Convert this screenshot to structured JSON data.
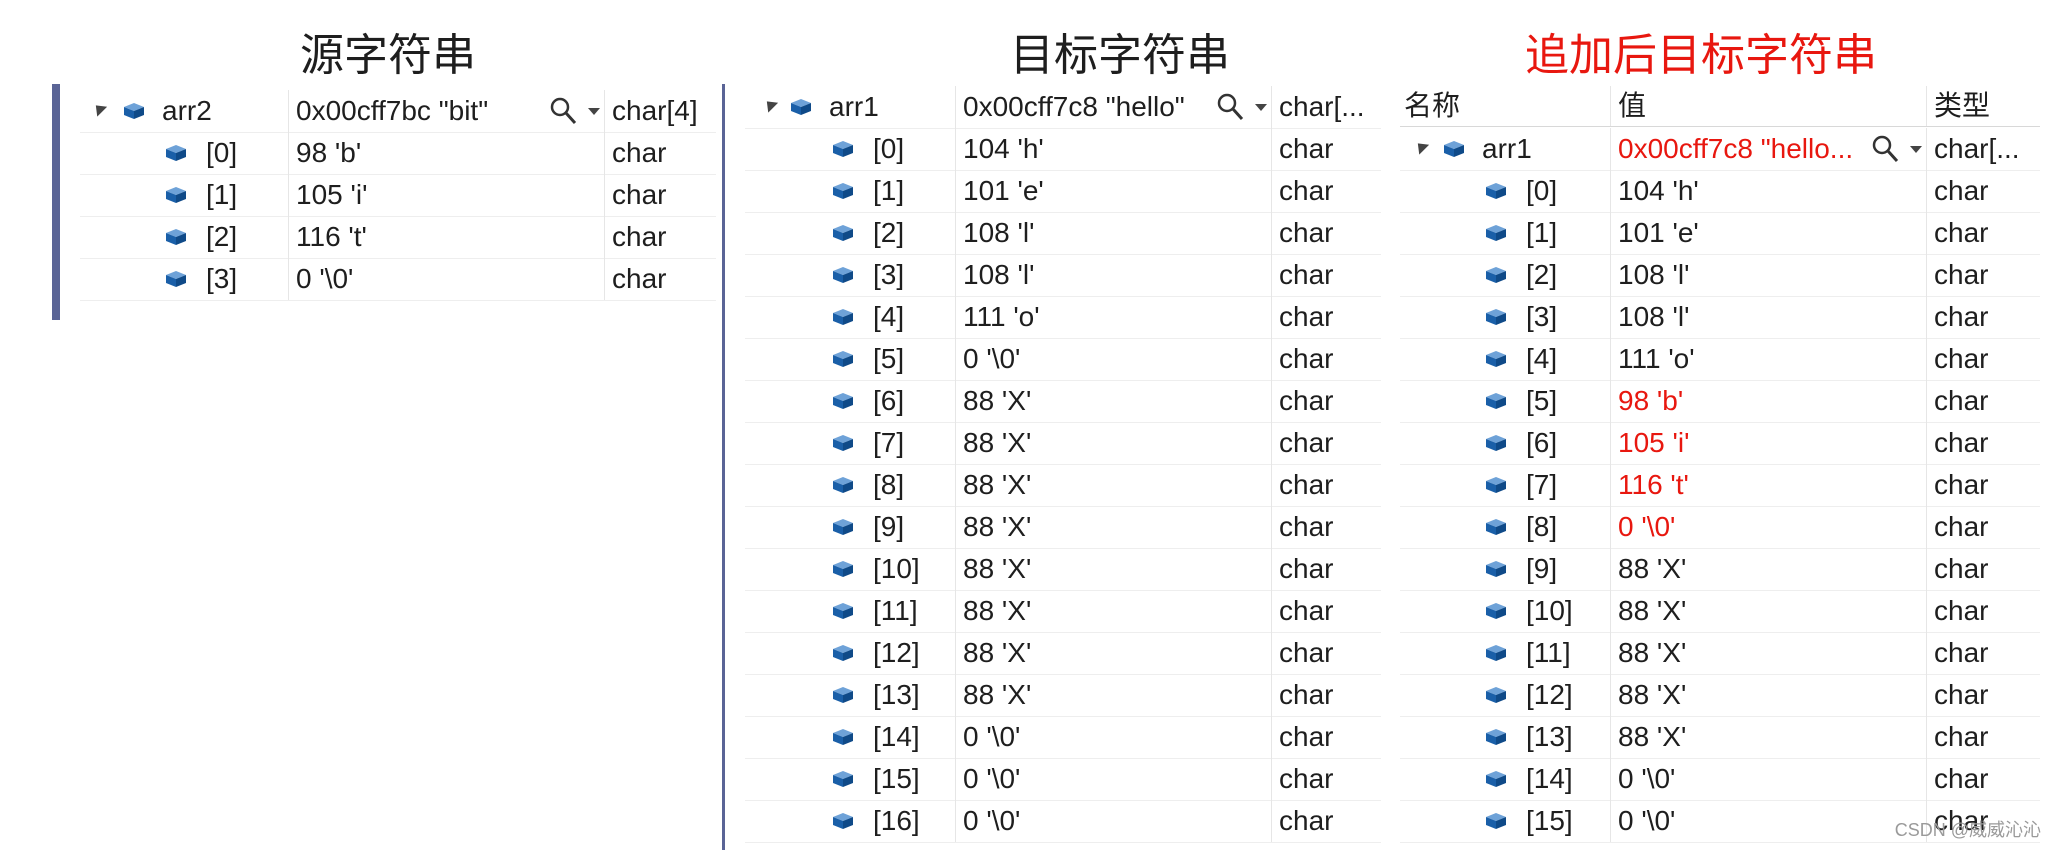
{
  "titles": {
    "source": "源字符串",
    "target": "目标字符串",
    "appended": "追加后目标字符串"
  },
  "panels": {
    "source": {
      "root": {
        "name": "arr2",
        "value": "0x00cff7bc \"bit\"",
        "type": "char[4]"
      },
      "items": [
        {
          "name": "[0]",
          "value": "98 'b'",
          "type": "char"
        },
        {
          "name": "[1]",
          "value": "105 'i'",
          "type": "char"
        },
        {
          "name": "[2]",
          "value": "116 't'",
          "type": "char"
        },
        {
          "name": "[3]",
          "value": "0 '\\0'",
          "type": "char"
        }
      ]
    },
    "target": {
      "root": {
        "name": "arr1",
        "value": "0x00cff7c8 \"hello\"",
        "type": "char[..."
      },
      "items": [
        {
          "name": "[0]",
          "value": "104 'h'",
          "type": "char"
        },
        {
          "name": "[1]",
          "value": "101 'e'",
          "type": "char"
        },
        {
          "name": "[2]",
          "value": "108 'l'",
          "type": "char"
        },
        {
          "name": "[3]",
          "value": "108 'l'",
          "type": "char"
        },
        {
          "name": "[4]",
          "value": "111 'o'",
          "type": "char"
        },
        {
          "name": "[5]",
          "value": "0 '\\0'",
          "type": "char"
        },
        {
          "name": "[6]",
          "value": "88 'X'",
          "type": "char"
        },
        {
          "name": "[7]",
          "value": "88 'X'",
          "type": "char"
        },
        {
          "name": "[8]",
          "value": "88 'X'",
          "type": "char"
        },
        {
          "name": "[9]",
          "value": "88 'X'",
          "type": "char"
        },
        {
          "name": "[10]",
          "value": "88 'X'",
          "type": "char"
        },
        {
          "name": "[11]",
          "value": "88 'X'",
          "type": "char"
        },
        {
          "name": "[12]",
          "value": "88 'X'",
          "type": "char"
        },
        {
          "name": "[13]",
          "value": "88 'X'",
          "type": "char"
        },
        {
          "name": "[14]",
          "value": "0 '\\0'",
          "type": "char"
        },
        {
          "name": "[15]",
          "value": "0 '\\0'",
          "type": "char"
        },
        {
          "name": "[16]",
          "value": "0 '\\0'",
          "type": "char"
        }
      ]
    },
    "appended": {
      "headers": {
        "name": "名称",
        "value": "值",
        "type": "类型"
      },
      "root": {
        "name": "arr1",
        "value": "0x00cff7c8 \"hello...",
        "type": "char[..."
      },
      "items": [
        {
          "name": "[0]",
          "value": "104 'h'",
          "type": "char"
        },
        {
          "name": "[1]",
          "value": "101 'e'",
          "type": "char"
        },
        {
          "name": "[2]",
          "value": "108 'l'",
          "type": "char"
        },
        {
          "name": "[3]",
          "value": "108 'l'",
          "type": "char"
        },
        {
          "name": "[4]",
          "value": "111 'o'",
          "type": "char"
        },
        {
          "name": "[5]",
          "value": "98 'b'",
          "type": "char"
        },
        {
          "name": "[6]",
          "value": "105 'i'",
          "type": "char"
        },
        {
          "name": "[7]",
          "value": "116 't'",
          "type": "char"
        },
        {
          "name": "[8]",
          "value": "0 '\\0'",
          "type": "char"
        },
        {
          "name": "[9]",
          "value": "88 'X'",
          "type": "char"
        },
        {
          "name": "[10]",
          "value": "88 'X'",
          "type": "char"
        },
        {
          "name": "[11]",
          "value": "88 'X'",
          "type": "char"
        },
        {
          "name": "[12]",
          "value": "88 'X'",
          "type": "char"
        },
        {
          "name": "[13]",
          "value": "88 'X'",
          "type": "char"
        },
        {
          "name": "[14]",
          "value": "0 '\\0'",
          "type": "char"
        },
        {
          "name": "[15]",
          "value": "0 '\\0'",
          "type": "char"
        }
      ],
      "changed_rows": [
        5,
        6,
        7,
        8
      ]
    }
  },
  "watermark": "CSDN @威威沁沁",
  "colors": {
    "changed": "#e8170f",
    "cube": "#1a5fa8",
    "separator": "#5a6496"
  },
  "icons": {
    "variable": "cube-icon",
    "search": "magnifier-icon",
    "expand": "expand-arrow-icon",
    "dropdown": "dropdown-arrow-icon"
  }
}
